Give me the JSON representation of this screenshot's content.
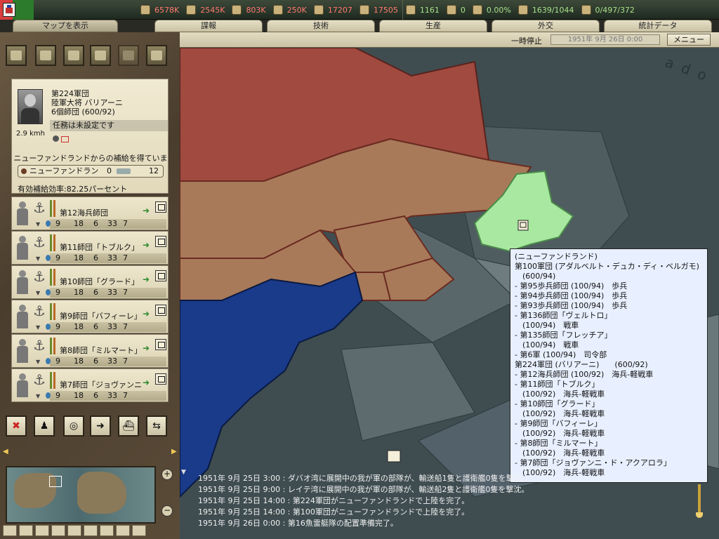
{
  "resources": [
    {
      "icon": "energy-icon",
      "value": "6578K"
    },
    {
      "icon": "metal-icon",
      "value": "2545K"
    },
    {
      "icon": "rare-materials-icon",
      "value": "803K"
    },
    {
      "icon": "oil-icon",
      "value": "250K"
    },
    {
      "icon": "supplies-icon",
      "value": "17207"
    },
    {
      "icon": "money-icon",
      "value": "17505"
    },
    {
      "icon": "manpower-icon",
      "value": "1161"
    },
    {
      "icon": "diplomacy-icon",
      "value": "0"
    },
    {
      "icon": "dissent-icon",
      "value": "0.00%"
    },
    {
      "icon": "transport-icon",
      "value": "1639/1044"
    },
    {
      "icon": "convoy-icon",
      "value": "0/497/372"
    }
  ],
  "tabs": {
    "map": "マップを表示",
    "intel": "諜報",
    "tech": "技術",
    "production": "生産",
    "diplomacy": "外交",
    "stats": "統計データ"
  },
  "timebar": {
    "pause": "一時停止",
    "date": "1951年 9月 26日 0:00",
    "menu": "メニュー"
  },
  "unit": {
    "name": "第224軍団",
    "commander": "陸軍大将 バリアーニ",
    "strength": "6個師団 (600/92)",
    "speed": "2.9 kmh",
    "mission": "任務は未設定です",
    "supply_note": "ニューファンドランドからの補給を得ています",
    "supply_name": "ニューファンドラン",
    "supply_v1": "0",
    "supply_v2": "12",
    "efficiency": "有効補給効率:82.25パーセント"
  },
  "divisions": [
    {
      "name": "第12海兵師団",
      "stats": [
        "9",
        "18",
        "6",
        "33",
        "7"
      ]
    },
    {
      "name": "第11師団「トブルク」",
      "stats": [
        "9",
        "18",
        "6",
        "33",
        "7"
      ]
    },
    {
      "name": "第10師団「グラード」",
      "stats": [
        "9",
        "18",
        "6",
        "33",
        "7"
      ]
    },
    {
      "name": "第9師団「バフィーレ」",
      "stats": [
        "9",
        "18",
        "6",
        "33",
        "7"
      ]
    },
    {
      "name": "第8師団「ミルマート」",
      "stats": [
        "9",
        "18",
        "6",
        "33",
        "7"
      ]
    },
    {
      "name": "第7師団「ジョヴァンニ・ド・アク",
      "stats": [
        "9",
        "18",
        "6",
        "33",
        "7"
      ]
    }
  ],
  "tooltip": [
    "(ニューファンドランド)",
    "第100軍団 (アダルベルト・デュカ・ディ・ベルガモ)",
    "　(600/94)",
    "- 第95歩兵師団 (100/94)　歩兵",
    "- 第94歩兵師団 (100/94)　歩兵",
    "- 第93歩兵師団 (100/94)　歩兵",
    "- 第136師団「ヴェルトロ」",
    "　(100/94)　戦車",
    "- 第135師団「フレッチア」",
    "　(100/94)　戦車",
    "- 第6軍 (100/94)　司令部",
    "第224軍団 (バリアーニ)　　(600/92)",
    "- 第12海兵師団 (100/92)　海兵-軽戦車",
    "- 第11師団「トブルク」",
    "　(100/92)　海兵-軽戦車",
    "- 第10師団「グラード」",
    "　(100/92)　海兵-軽戦車",
    "- 第9師団「バフィーレ」",
    "　(100/92)　海兵-軽戦車",
    "- 第8師団「ミルマート」",
    "　(100/92)　海兵-軽戦車",
    "- 第7師団「ジョヴァンニ・ド・アクアロラ」",
    "　(100/92)　海兵-軽戦車"
  ],
  "log": [
    "1951年 9月 25日 3:00 : ダバオ湾に展開中の我が軍の部隊が、輸送船1隻と護衛艦0隻を撃沈。",
    "1951年 9月 25日 9:00 : レイテ湾に展開中の我が軍の部隊が、輸送船2隻と護衛艦0隻を撃沈。",
    "1951年 9月 25日 14:00 : 第224軍団がニューファンドランドで上陸を完了。",
    "1951年 9月 25日 14:00 : 第100軍団がニューファンドランドで上陸を完了。",
    "1951年 9月 26日 0:00 : 第16魚雷艇隊の配置準備完了。"
  ],
  "map": {
    "label": "ado",
    "colors": {
      "sea": "#3f4d50",
      "sea_light": "#6e7c7f",
      "enemy_red": "#a04a40",
      "land_brown": "#a87a5a",
      "usa_blue": "#1a3a8a",
      "friendly_green": "#a8e8a0"
    }
  }
}
